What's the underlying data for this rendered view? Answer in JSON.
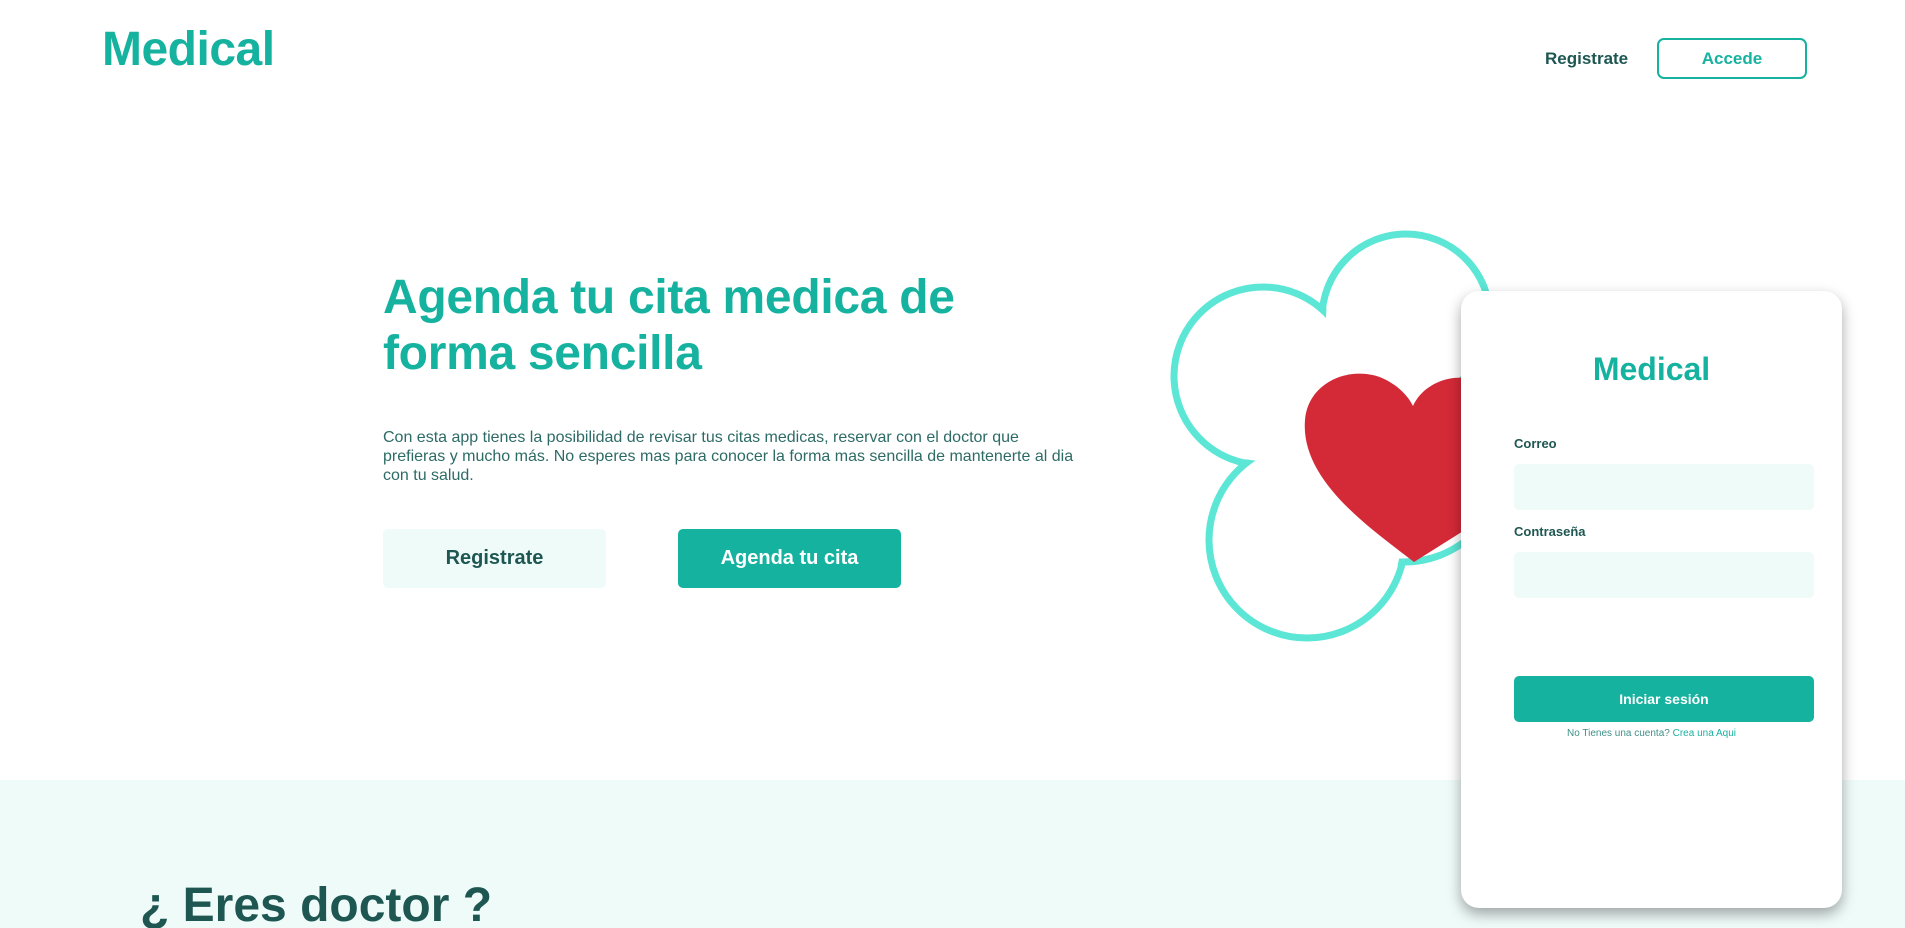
{
  "header": {
    "logo": "Medical",
    "register_label": "Registrate",
    "login_label": "Accede"
  },
  "hero": {
    "title": "Agenda tu cita medica de forma sencilla",
    "description": "Con esta app tienes la posibilidad de revisar tus citas medicas, reservar con el doctor que prefieras y mucho más. No esperes mas para conocer la forma mas sencilla de mantenerte al dia con tu salud.",
    "register_button": "Registrate",
    "appointment_button": "Agenda tu cita"
  },
  "login_card": {
    "logo": "Medical",
    "email_label": "Correo",
    "email_value": "",
    "password_label": "Contraseña",
    "password_value": "",
    "submit_label": "Iniciar sesión",
    "footer_text": "No Tienes una cuenta? ",
    "footer_link": "Crea una Aqui"
  },
  "doctor_section": {
    "title": "¿ Eres doctor ?"
  },
  "colors": {
    "brand": "#16b2a0",
    "dark_text": "#1e5752",
    "light_bg": "#effbf9",
    "outline": "#5ce6d5",
    "heart": "#d42a38"
  },
  "icons": {
    "illustration": "heart-icon"
  }
}
